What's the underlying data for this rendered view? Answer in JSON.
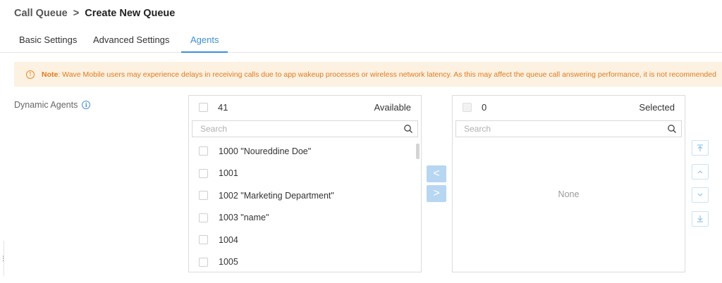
{
  "breadcrumb": {
    "parent": "Call Queue",
    "separator": ">",
    "current": "Create New Queue"
  },
  "tabs": [
    {
      "label": "Basic Settings",
      "active": false
    },
    {
      "label": "Advanced Settings",
      "active": false
    },
    {
      "label": "Agents",
      "active": true
    }
  ],
  "note": {
    "icon": "!",
    "label": "Note",
    "text": ": Wave Mobile users may experience delays in receiving calls due to app wakeup processes or wireless network latency. As this may affect the queue call answering performance, it is not recommended"
  },
  "dynamic_agents": {
    "label": "Dynamic Agents",
    "info_icon": "i",
    "available": {
      "count": "41",
      "title": "Available",
      "search_placeholder": "Search",
      "items": [
        "1000 \"Noureddine Doe\"",
        "1001",
        "1002 \"Marketing Department\"",
        "1003 \"name\"",
        "1004",
        "1005"
      ]
    },
    "selected": {
      "count": "0",
      "title": "Selected",
      "search_placeholder": "Search",
      "empty_text": "None"
    },
    "transfer": {
      "move_left": "<",
      "move_right": ">"
    }
  },
  "colors": {
    "accent": "#3d8fd6",
    "note_bg": "#fdf1e1",
    "note_text": "#e07a1f",
    "transfer_btn": "#b7d6f2"
  }
}
